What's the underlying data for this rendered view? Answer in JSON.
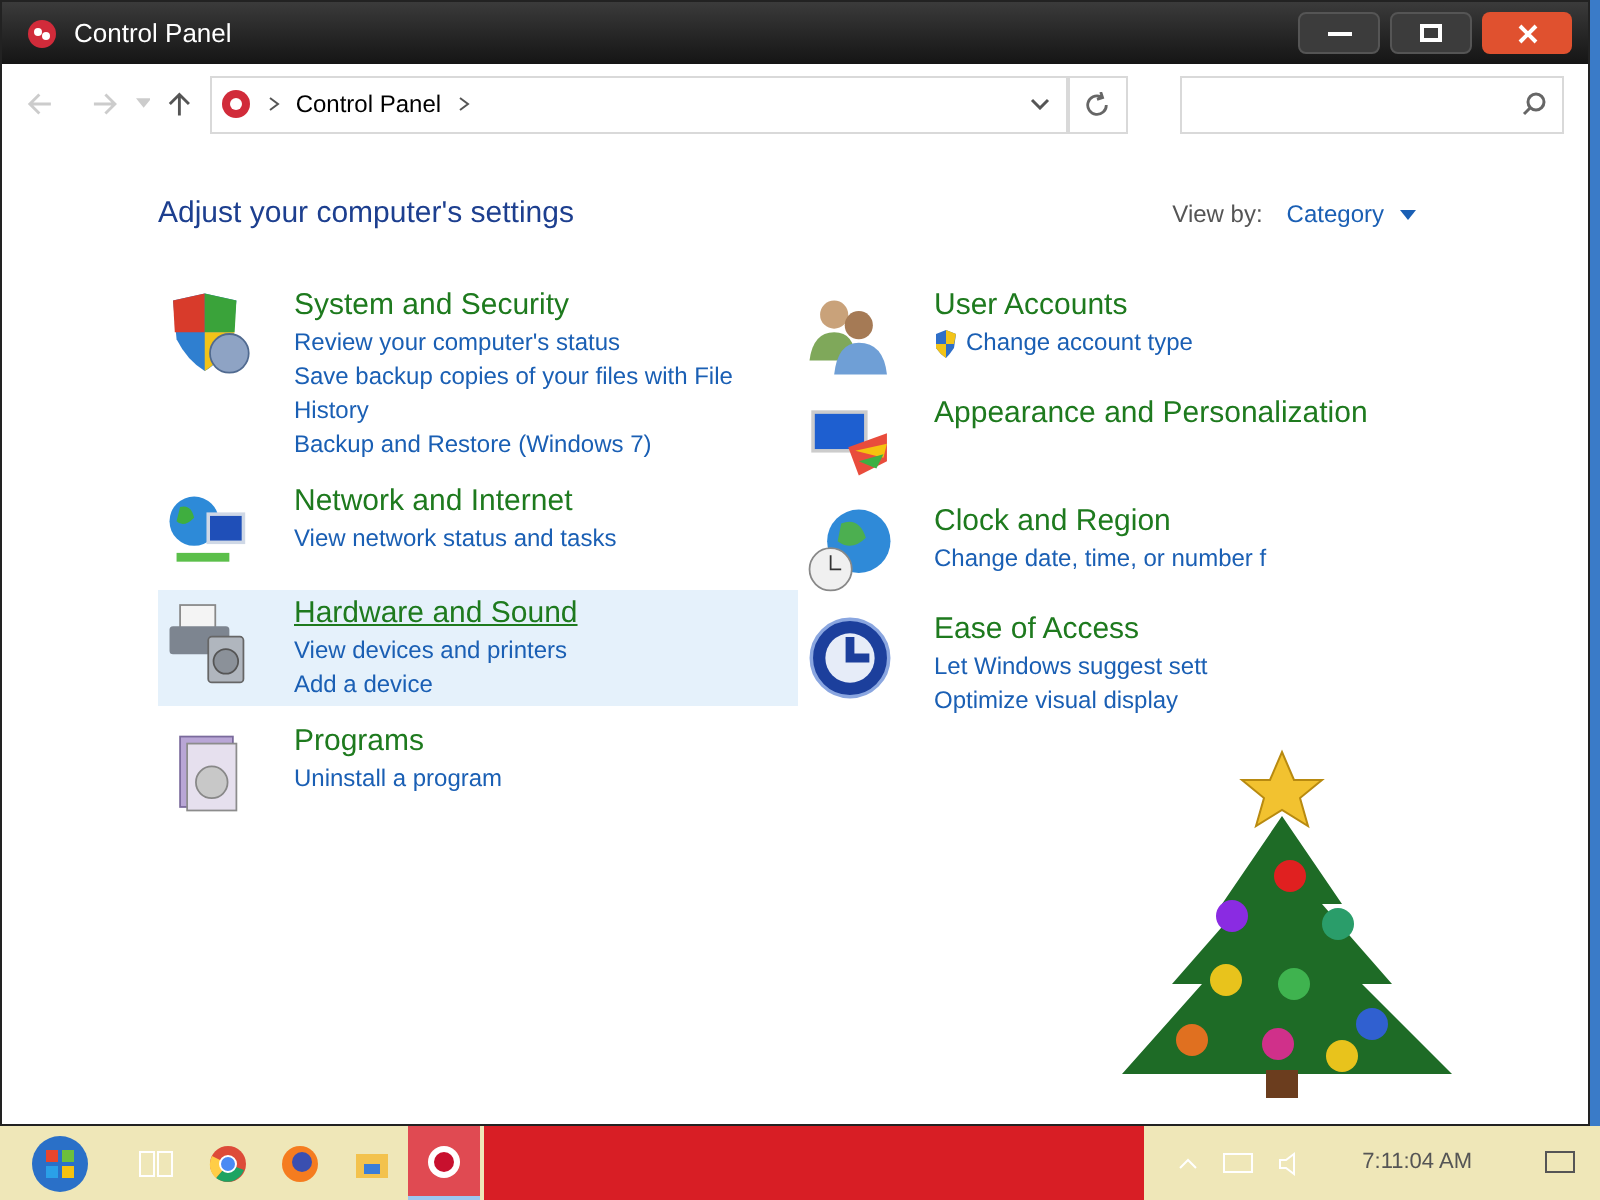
{
  "window": {
    "title": "Control Panel"
  },
  "address_bar": {
    "path": [
      "Control Panel"
    ]
  },
  "heading": "Adjust your computer's settings",
  "view_by": {
    "label": "View by:",
    "value": "Category"
  },
  "left_categories": [
    {
      "kind": "security",
      "title": "System and Security",
      "hovered": false,
      "links": [
        {
          "text": "Review your computer's status",
          "shield": false
        },
        {
          "text": "Save backup copies of your files with File History",
          "shield": false
        },
        {
          "text": "Backup and Restore (Windows 7)",
          "shield": false
        }
      ]
    },
    {
      "kind": "network",
      "title": "Network and Internet",
      "hovered": false,
      "links": [
        {
          "text": "View network status and tasks",
          "shield": false
        }
      ]
    },
    {
      "kind": "hardware",
      "title": "Hardware and Sound",
      "hovered": true,
      "links": [
        {
          "text": "View devices and printers",
          "shield": false
        },
        {
          "text": "Add a device",
          "shield": false
        }
      ]
    },
    {
      "kind": "programs",
      "title": "Programs",
      "hovered": false,
      "links": [
        {
          "text": "Uninstall a program",
          "shield": false
        }
      ]
    }
  ],
  "right_categories": [
    {
      "kind": "users",
      "title": "User Accounts",
      "hovered": false,
      "links": [
        {
          "text": "Change account type",
          "shield": true
        }
      ]
    },
    {
      "kind": "appearance",
      "title": "Appearance and Personalization",
      "hovered": false
    },
    {
      "kind": "clock",
      "title": "Clock and Region",
      "hovered": false,
      "links": [
        {
          "text": "Change date, time, or number f",
          "shield": false
        }
      ]
    },
    {
      "kind": "access",
      "title": "Ease of Access",
      "hovered": false,
      "links": [
        {
          "text": "Let Windows suggest sett",
          "shield": false
        },
        {
          "text": "Optimize visual display",
          "shield": false
        }
      ]
    }
  ],
  "taskbar": {
    "apps": [
      {
        "kind": "taskview",
        "selected": false
      },
      {
        "kind": "chrome",
        "selected": false
      },
      {
        "kind": "firefox",
        "selected": false
      },
      {
        "kind": "explorer",
        "selected": false
      },
      {
        "kind": "controlpanel",
        "selected": true
      }
    ],
    "clock": "7:11:04 AM"
  }
}
